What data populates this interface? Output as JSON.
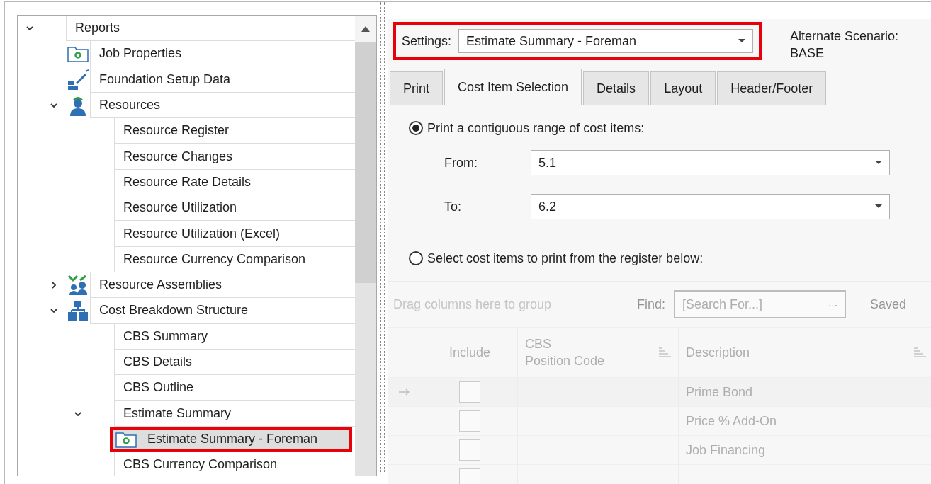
{
  "tree": {
    "items": [
      {
        "label": "Reports",
        "expanded": true,
        "selected": false,
        "children": [
          {
            "label": "Job Properties",
            "kind": "folder",
            "selected": false
          },
          {
            "label": "Foundation Setup Data",
            "kind": "setup",
            "selected": false
          },
          {
            "label": "Resources",
            "kind": "worker",
            "expanded": true,
            "selected": false,
            "children": [
              {
                "label": "Resource Register",
                "selected": false
              },
              {
                "label": "Resource Changes",
                "selected": false
              },
              {
                "label": "Resource Rate Details",
                "selected": false
              },
              {
                "label": "Resource Utilization",
                "selected": false
              },
              {
                "label": "Resource Utilization (Excel)",
                "selected": false
              },
              {
                "label": "Resource Currency Comparison",
                "selected": false
              }
            ]
          },
          {
            "label": "Resource Assemblies",
            "kind": "assemblies",
            "expanded": false,
            "selected": false
          },
          {
            "label": "Cost Breakdown Structure",
            "kind": "hierarchy",
            "expanded": true,
            "selected": false,
            "children": [
              {
                "label": "CBS Summary",
                "selected": false
              },
              {
                "label": "CBS Details",
                "selected": false
              },
              {
                "label": "CBS Outline",
                "selected": false
              },
              {
                "label": "Estimate Summary",
                "expanded": true,
                "selected": false,
                "children": [
                  {
                    "label": "Estimate Summary - Foreman",
                    "kind": "folder",
                    "selected": true,
                    "highlighted": true
                  }
                ]
              },
              {
                "label": "CBS Currency Comparison",
                "selected": false
              }
            ]
          }
        ]
      }
    ]
  },
  "settings": {
    "label": "Settings:",
    "value": "Estimate Summary - Foreman",
    "highlighted": true
  },
  "alternate_scenario": {
    "label": "Alternate Scenario:",
    "value": "BASE"
  },
  "tabs": [
    {
      "label": "Print",
      "selected": false
    },
    {
      "label": "Cost Item Selection",
      "selected": true
    },
    {
      "label": "Details",
      "selected": false
    },
    {
      "label": "Layout",
      "selected": false
    },
    {
      "label": "Header/Footer",
      "selected": false
    }
  ],
  "range_option": {
    "label": "Print a contiguous range of cost items:",
    "selected": true
  },
  "range_fields": [
    {
      "label": "From:",
      "value": "5.1"
    },
    {
      "label": "To:",
      "value": "6.2"
    }
  ],
  "register_option": {
    "label": "Select cost items to print from the register below:",
    "selected": false
  },
  "grid": {
    "disabled": true,
    "group_hint": "Drag columns here to group",
    "find_label": "Find:",
    "find_placeholder": "[Search For...]",
    "find_button": "···",
    "saved_label": "Saved",
    "columns": [
      {
        "label": "Include"
      },
      {
        "label": "CBS\nPosition Code"
      },
      {
        "label": "Description"
      }
    ],
    "rows": [
      {
        "current": true,
        "checked": false,
        "description": "Prime Bond"
      },
      {
        "current": false,
        "checked": false,
        "description": "Price % Add-On"
      },
      {
        "current": false,
        "checked": false,
        "description": "Job Financing"
      },
      {
        "current": false,
        "checked": false
      }
    ]
  }
}
